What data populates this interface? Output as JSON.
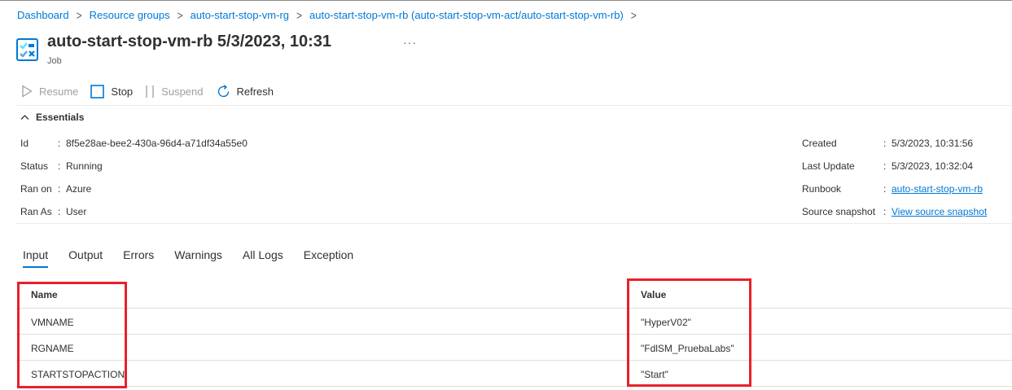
{
  "breadcrumb": [
    "Dashboard",
    "Resource groups",
    "auto-start-stop-vm-rg",
    "auto-start-stop-vm-rb (auto-start-stop-vm-act/auto-start-stop-vm-rb)"
  ],
  "header": {
    "title": "auto-start-stop-vm-rb 5/3/2023, 10:31",
    "more": "···",
    "subtitle": "Job"
  },
  "toolbar": {
    "resume": "Resume",
    "stop": "Stop",
    "suspend": "Suspend",
    "refresh": "Refresh"
  },
  "essentials": {
    "heading": "Essentials",
    "left": [
      {
        "label": "Id",
        "value": "8f5e28ae-bee2-430a-96d4-a71df34a55e0"
      },
      {
        "label": "Status",
        "value": "Running"
      },
      {
        "label": "Ran on",
        "value": "Azure"
      },
      {
        "label": "Ran As",
        "value": "User"
      }
    ],
    "right": [
      {
        "label": "Created",
        "value": "5/3/2023, 10:31:56"
      },
      {
        "label": "Last Update",
        "value": "5/3/2023, 10:32:04"
      },
      {
        "label": "Runbook",
        "value": "auto-start-stop-vm-rb"
      },
      {
        "label": "Source snapshot",
        "value": "View source snapshot"
      }
    ]
  },
  "tabs": [
    "Input",
    "Output",
    "Errors",
    "Warnings",
    "All Logs",
    "Exception"
  ],
  "input_table": {
    "headers": {
      "name": "Name",
      "value": "Value"
    },
    "rows": [
      {
        "name": "VMNAME",
        "value": "\"HyperV02\""
      },
      {
        "name": "RGNAME",
        "value": "\"FdlSM_PruebaLabs\""
      },
      {
        "name": "STARTSTOPACTION",
        "value": "\"Start\""
      }
    ]
  },
  "colors": {
    "accent": "#0078d4",
    "highlight_box": "#e8202a"
  }
}
